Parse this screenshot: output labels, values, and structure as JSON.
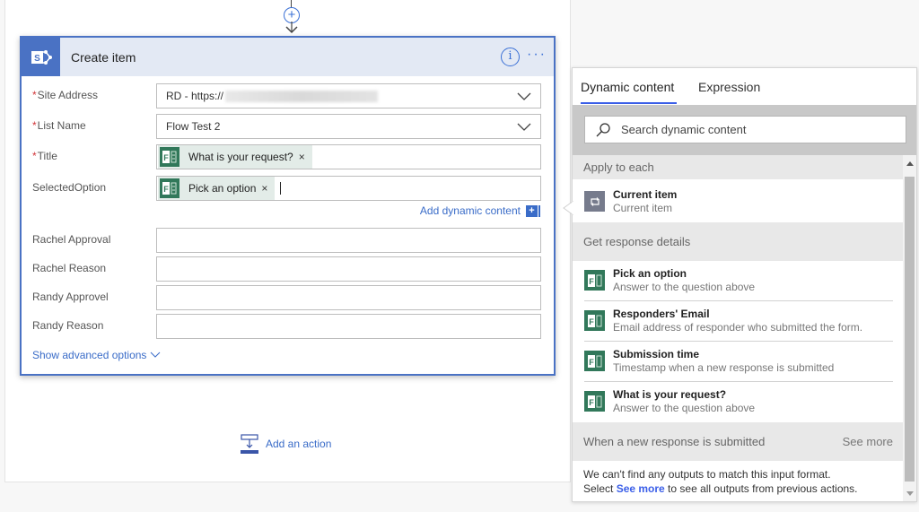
{
  "canvas": {
    "insert_step_symbol": "+"
  },
  "card": {
    "title": "Create item",
    "icon": "sharepoint-icon",
    "info_symbol": "i",
    "more_symbol": "···",
    "fields": [
      {
        "label": "Site Address",
        "required": true,
        "type": "dropdown",
        "value_prefix": "RD - https://",
        "value_redacted": true
      },
      {
        "label": "List Name",
        "required": true,
        "type": "dropdown",
        "value": "Flow Test 2"
      },
      {
        "label": "Title",
        "required": true,
        "type": "token",
        "token": "What is your request?"
      },
      {
        "label": "SelectedOption",
        "required": false,
        "type": "token",
        "token": "Pick an option"
      },
      {
        "label": "Rachel Approval",
        "required": false,
        "type": "text",
        "value": ""
      },
      {
        "label": "Rachel Reason",
        "required": false,
        "type": "text",
        "value": ""
      },
      {
        "label": "Randy Approvel",
        "required": false,
        "type": "text",
        "value": ""
      },
      {
        "label": "Randy Reason",
        "required": false,
        "type": "text",
        "value": ""
      }
    ],
    "required_mark": "*",
    "token_close": "×",
    "add_dynamic_content": "Add dynamic content",
    "add_dynamic_symbol": "+",
    "show_advanced": "Show advanced options"
  },
  "add_action": "Add an action",
  "panel": {
    "tabs": [
      {
        "label": "Dynamic content",
        "active": true
      },
      {
        "label": "Expression",
        "active": false
      }
    ],
    "search_placeholder": "Search dynamic content",
    "groups": [
      {
        "header": "Apply to each",
        "items": [
          {
            "title": "Current item",
            "subtitle": "Current item",
            "icon": "loop-icon"
          }
        ]
      },
      {
        "header": "Get response details",
        "items": [
          {
            "title": "Pick an option",
            "subtitle": "Answer to the question above",
            "icon": "forms-icon"
          },
          {
            "title": "Responders' Email",
            "subtitle": "Email address of responder who submitted the form.",
            "icon": "forms-icon"
          },
          {
            "title": "Submission time",
            "subtitle": "Timestamp when a new response is submitted",
            "icon": "forms-icon"
          },
          {
            "title": "What is your request?",
            "subtitle": "Answer to the question above",
            "icon": "forms-icon"
          }
        ]
      },
      {
        "header": "When a new response is submitted",
        "see_more": "See more",
        "note_line1": "We can't find any outputs to match this input format.",
        "note_pre": "Select ",
        "note_link": "See more",
        "note_post": " to see all outputs from previous actions."
      }
    ]
  },
  "colors": {
    "accent": "#3a6cc8",
    "card_border": "#4a72c4",
    "header_bg": "#e3e9f4",
    "forms_green": "#31785a",
    "required_red": "#d13438",
    "tab_underline": "#3a5ee8"
  }
}
